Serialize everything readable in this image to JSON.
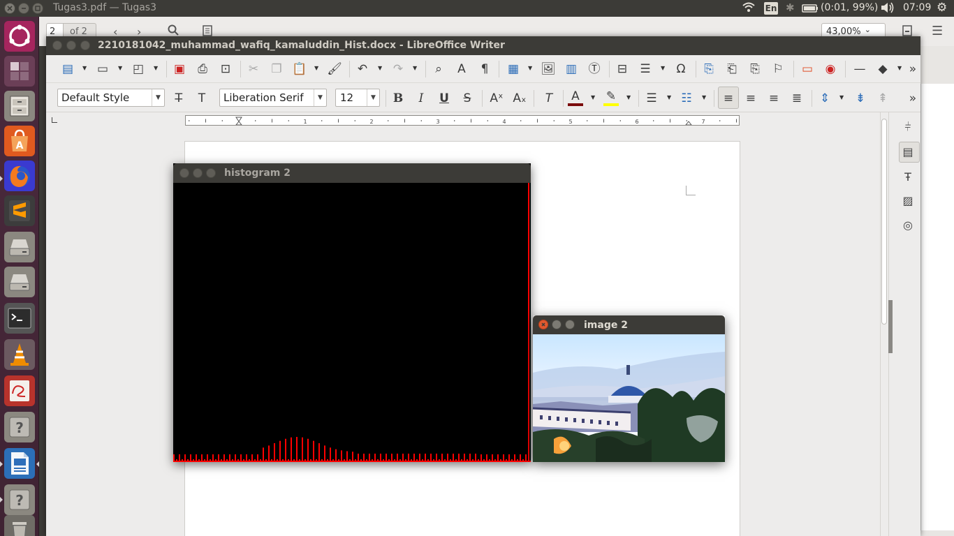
{
  "top_panel": {
    "window_title": "Tugas3.pdf — Tugas3",
    "keyboard_layout": "En",
    "battery": "(0:01, 99%)",
    "clock": "07:09"
  },
  "pdf_viewer": {
    "page_current": "2",
    "page_of": "of 2",
    "zoom": "43,00%"
  },
  "writer": {
    "title": "2210181042_muhammad_wafiq_kamaluddin_Hist.docx - LibreOffice Writer",
    "paragraph_style": "Default Style",
    "font_name": "Liberation Serif",
    "font_size": "12",
    "ruler_numbers": [
      "1",
      "2",
      "3",
      "4",
      "5",
      "6",
      "7"
    ],
    "overflow_glyph": "»",
    "font_color": "#7b0c0c",
    "highlight_color": "#ffff00"
  },
  "histogram_window": {
    "title": "histogram 2",
    "bar_color": "#ff0000"
  },
  "image_window": {
    "title": "image 2"
  }
}
